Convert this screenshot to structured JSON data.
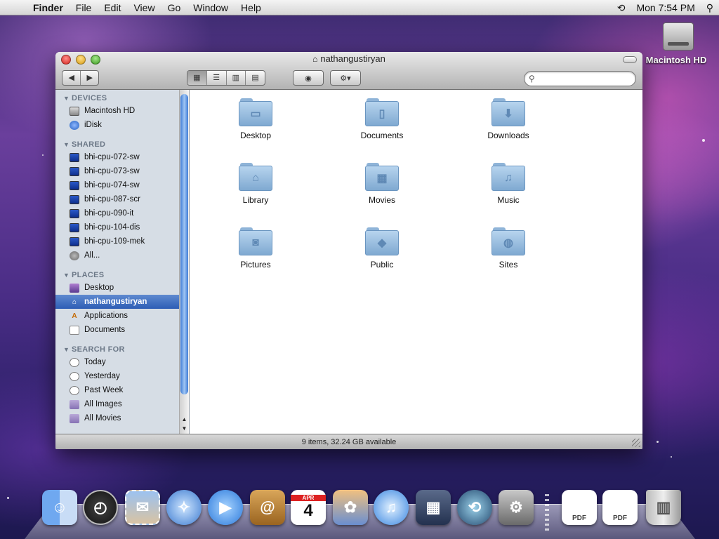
{
  "menubar": {
    "app": "Finder",
    "items": [
      "File",
      "Edit",
      "View",
      "Go",
      "Window",
      "Help"
    ],
    "clock": "Mon 7:54 PM"
  },
  "desktop_icon": {
    "label": "Macintosh HD"
  },
  "window": {
    "title": "nathangustiryan",
    "status": "9 items, 32.24 GB available"
  },
  "sidebar": {
    "devices_header": "DEVICES",
    "devices": [
      "Macintosh HD",
      "iDisk"
    ],
    "shared_header": "SHARED",
    "shared": [
      "bhi-cpu-072-sw",
      "bhi-cpu-073-sw",
      "bhi-cpu-074-sw",
      "bhi-cpu-087-scr",
      "bhi-cpu-090-it",
      "bhi-cpu-104-dis",
      "bhi-cpu-109-mek",
      "All..."
    ],
    "places_header": "PLACES",
    "places": [
      "Desktop",
      "nathangustiryan",
      "Applications",
      "Documents"
    ],
    "search_header": "SEARCH FOR",
    "search": [
      "Today",
      "Yesterday",
      "Past Week",
      "All Images",
      "All Movies"
    ]
  },
  "folders": [
    "Desktop",
    "Documents",
    "Downloads",
    "Library",
    "Movies",
    "Music",
    "Pictures",
    "Public",
    "Sites"
  ],
  "dock": {
    "calendar_month": "APR",
    "calendar_day": "4",
    "pdf_label": "PDF"
  },
  "colors": {
    "selection": "#2d5db5",
    "folder": "#8fb4d8"
  }
}
